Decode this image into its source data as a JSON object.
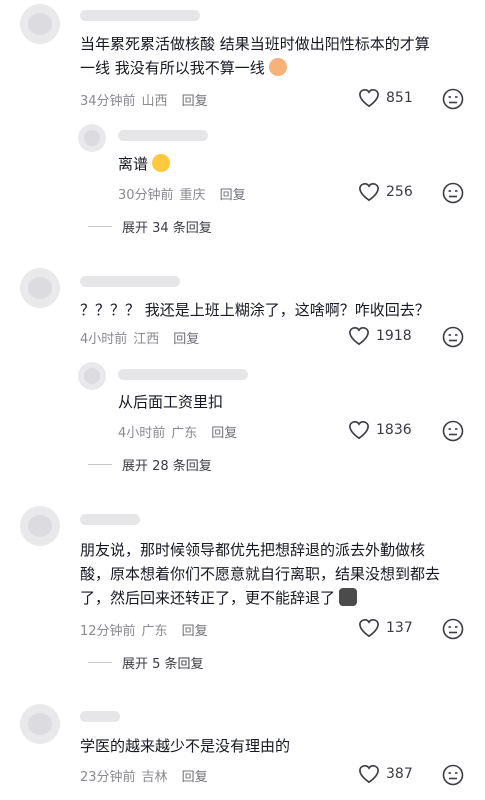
{
  "comments": [
    {
      "text": "当年累死累活做核酸 结果当班时做出阳性标本的才算一线 我没有所以我不算一线",
      "time": "34分钟前",
      "location": "山西",
      "reply_label": "回复",
      "likes": "851",
      "replies": [
        {
          "text": "离谱",
          "time": "30分钟前",
          "location": "重庆",
          "reply_label": "回复",
          "likes": "256"
        }
      ],
      "expand_label": "展开 34 条回复"
    },
    {
      "text": "？？？？ 我还是上班上糊涂了，这啥啊？咋收回去？",
      "time": "4小时前",
      "location": "江西",
      "reply_label": "回复",
      "likes": "1918",
      "replies": [
        {
          "text": "从后面工资里扣",
          "time": "4小时前",
          "location": "广东",
          "reply_label": "回复",
          "likes": "1836"
        }
      ],
      "expand_label": "展开 28 条回复"
    },
    {
      "text": "朋友说，那时候领导都优先把想辞退的派去外勤做核酸，原本想着你们不愿意就自行离职，结果没想到都去了，然后回来还转正了，更不能辞退了",
      "time": "12分钟前",
      "location": "广东",
      "reply_label": "回复",
      "likes": "137",
      "expand_label": "展开 5 条回复"
    },
    {
      "text": "学医的越来越少不是没有理由的",
      "time": "23分钟前",
      "location": "吉林",
      "reply_label": "回复",
      "likes": "387"
    }
  ],
  "icons": {
    "like": "heart-outline-icon",
    "dislike": "dislike-face-icon",
    "emoji_1": "crying-face-emoji",
    "emoji_2": "upside-down-face-emoji",
    "emoji_3": "cat-emoji"
  },
  "colors": {
    "text": "#161823",
    "meta": "#8a8b91",
    "placeholder": "#e6e6e8"
  }
}
